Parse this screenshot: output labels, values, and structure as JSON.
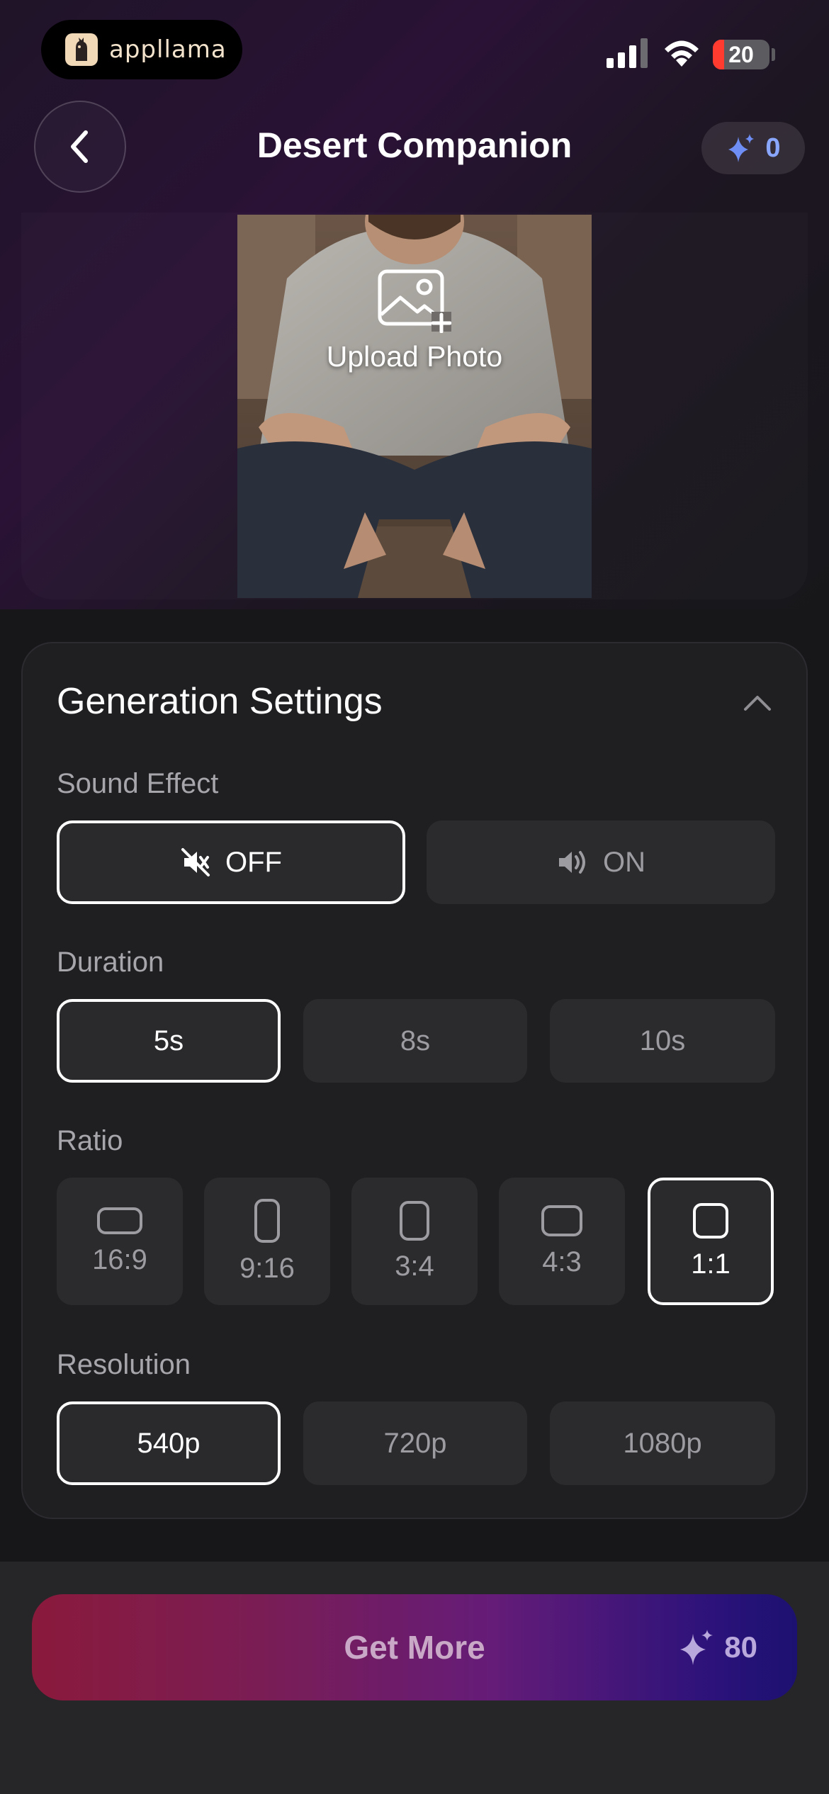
{
  "status_bar": {
    "brand": "appllama",
    "battery": "20"
  },
  "header": {
    "title": "Desert Companion",
    "credits": "0"
  },
  "preview": {
    "upload_label": "Upload Photo"
  },
  "settings": {
    "title": "Generation Settings",
    "sound": {
      "label": "Sound Effect",
      "options": [
        "OFF",
        "ON"
      ],
      "selected": "OFF"
    },
    "duration": {
      "label": "Duration",
      "options": [
        "5s",
        "8s",
        "10s"
      ],
      "selected": "5s"
    },
    "ratio": {
      "label": "Ratio",
      "options": [
        "16:9",
        "9:16",
        "3:4",
        "4:3",
        "1:1"
      ],
      "selected": "1:1"
    },
    "resolution": {
      "label": "Resolution",
      "options": [
        "540p",
        "720p",
        "1080p"
      ],
      "selected": "540p"
    }
  },
  "cta": {
    "label": "Get More",
    "cost": "80"
  },
  "colors": {
    "accent_blue": "#8aa7ff",
    "cta_start": "#8a1a3c",
    "cta_end": "#1c1170"
  }
}
